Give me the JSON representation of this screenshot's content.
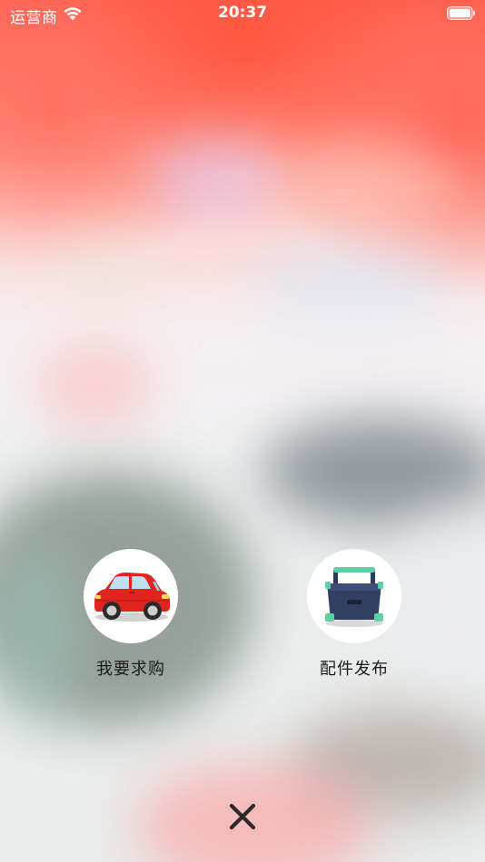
{
  "status_bar": {
    "carrier": "运营商",
    "time": "20:37",
    "wifi_icon": "wifi-icon",
    "battery_icon": "battery-icon"
  },
  "actions": [
    {
      "label": "我要求购",
      "icon": "red-car-icon"
    },
    {
      "label": "配件发布",
      "icon": "toolbox-icon"
    }
  ],
  "close": {
    "icon": "close-icon"
  },
  "colors": {
    "backdrop_top": "#ff6150",
    "label_text": "#1a1a1a",
    "circle_bg": "#ffffff",
    "close_icon": "#2b2b2b"
  }
}
